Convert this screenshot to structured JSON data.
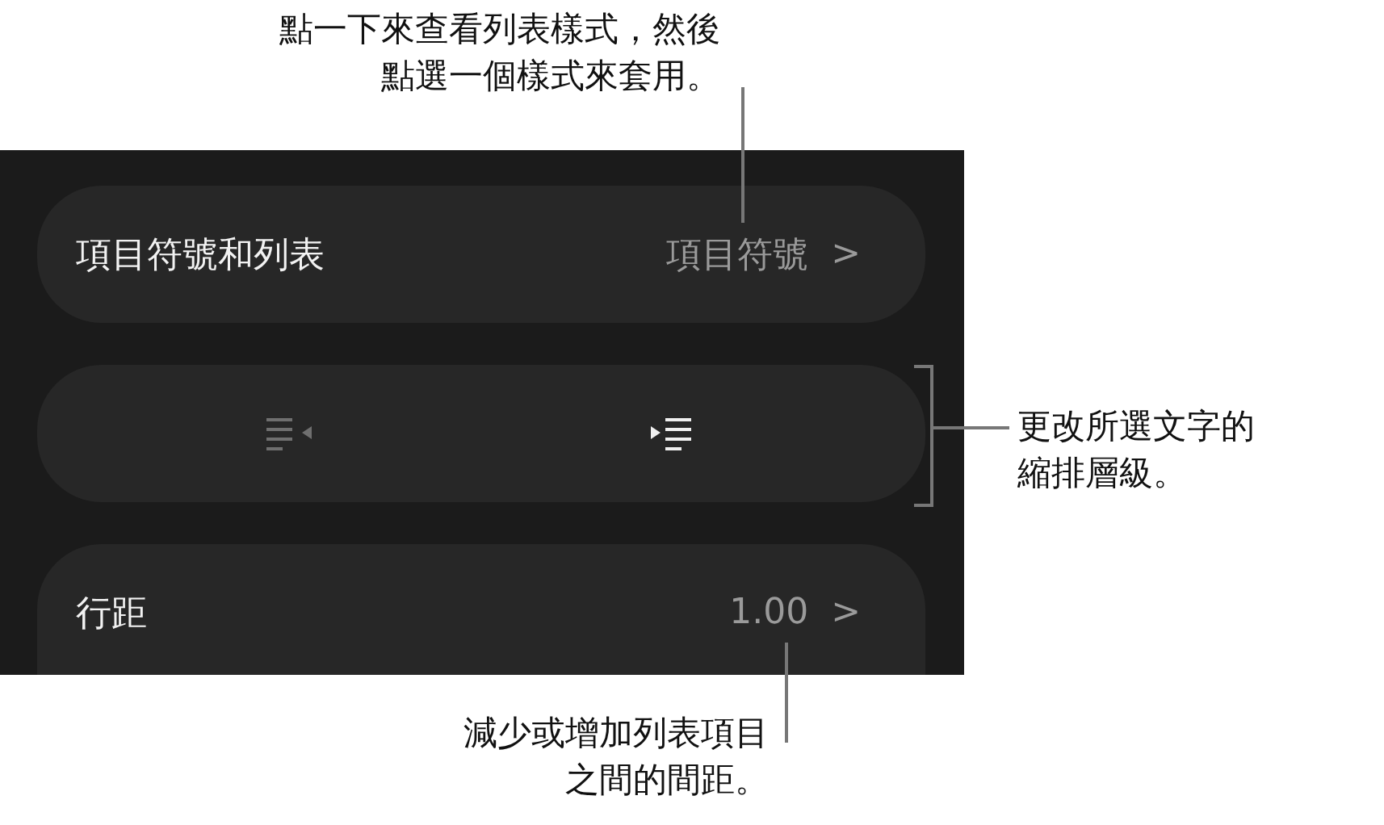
{
  "panel": {
    "rows": [
      {
        "kind": "nav",
        "label": "項目符號和列表",
        "value": "項目符號",
        "chevron": ">"
      },
      {
        "kind": "indent",
        "buttons": [
          {
            "kind": "outdent",
            "disabled": true
          },
          {
            "kind": "indent",
            "disabled": false
          }
        ]
      },
      {
        "kind": "nav",
        "label": "行距",
        "value": "1.00",
        "chevron": ">"
      }
    ]
  },
  "callouts": [
    {
      "lines": [
        "點一下來查看列表樣式，然後",
        "點選一個樣式來套用。"
      ]
    },
    {
      "lines": [
        "更改所選文字的",
        "縮排層級。"
      ]
    },
    {
      "lines": [
        "減少或增加列表項目",
        "之間的間距。"
      ]
    }
  ]
}
